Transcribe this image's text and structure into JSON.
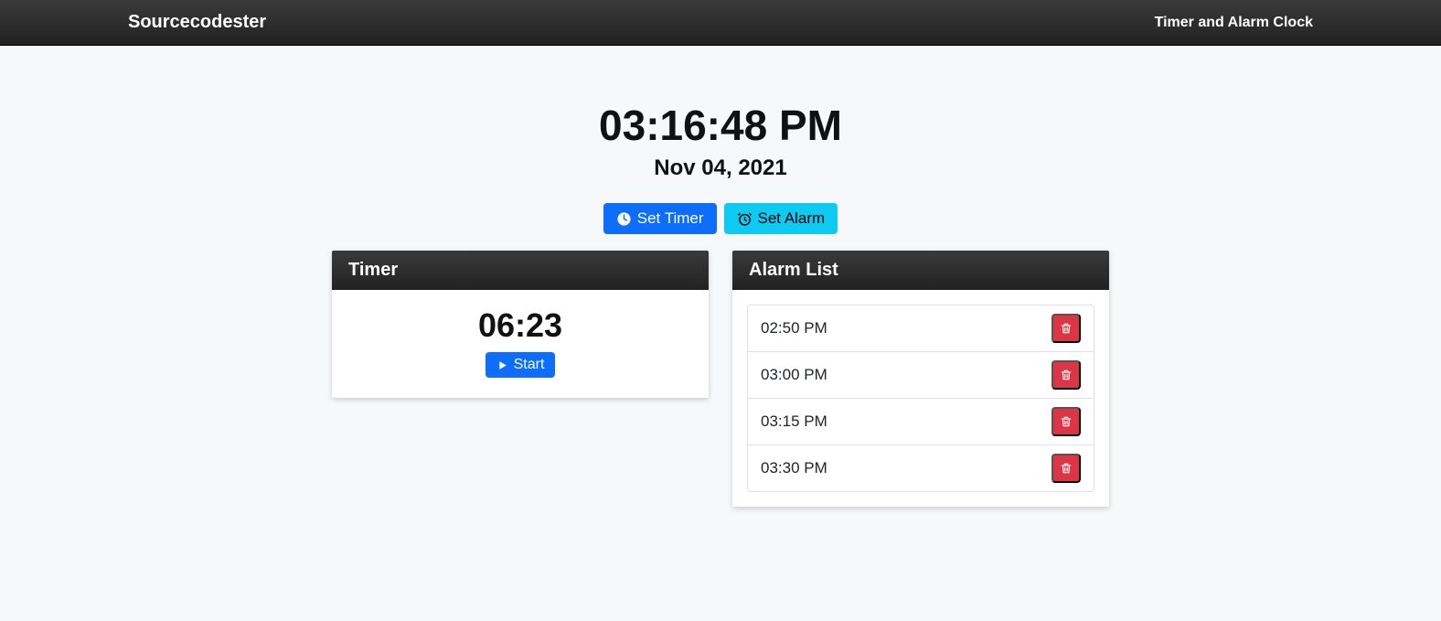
{
  "navbar": {
    "brand": "Sourcecodester",
    "text": "Timer and Alarm Clock"
  },
  "clock": {
    "time": "03:16:48 PM",
    "date": "Nov 04, 2021"
  },
  "buttons": {
    "set_timer": "Set Timer",
    "set_alarm": "Set Alarm",
    "start": "Start"
  },
  "timer": {
    "title": "Timer",
    "value": "06:23"
  },
  "alarms": {
    "title": "Alarm List",
    "items": [
      {
        "time": "02:50 PM"
      },
      {
        "time": "03:00 PM"
      },
      {
        "time": "03:15 PM"
      },
      {
        "time": "03:30 PM"
      }
    ]
  },
  "icons": {
    "clock": "clock-icon",
    "alarm": "alarm-icon",
    "play": "play-icon",
    "trash": "trash-icon"
  }
}
